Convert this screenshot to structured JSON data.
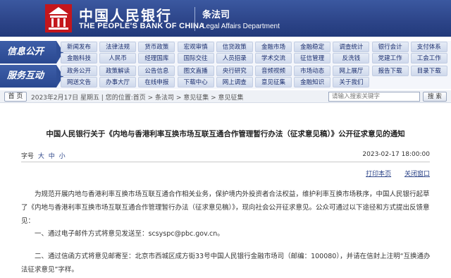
{
  "header": {
    "bank_name_cn": "中国人民银行",
    "bank_name_en": "THE PEOPLE'S BANK OF CHINA",
    "dept_cn": "条法司",
    "dept_en": "Legal Affairs Department"
  },
  "nav": {
    "section1_label": "信息公开",
    "section2_label": "服务互动",
    "row1": [
      "新闻发布",
      "法律法规",
      "货币政策",
      "宏观审慎",
      "信贷政策",
      "金融市场",
      "金融稳定",
      "调查统计",
      "银行会计",
      "支付体系"
    ],
    "row2": [
      "金融科技",
      "人民币",
      "经理国库",
      "国际交往",
      "人员招录",
      "学术交流",
      "征信管理",
      "反洗钱",
      "党建工作",
      "工会工作"
    ],
    "row3": [
      "政务公开",
      "政策解读",
      "公告信息",
      "图文直播",
      "央行研究",
      "音频视频",
      "市场动态",
      "网上展厅",
      "报告下载",
      "目录下载"
    ],
    "row4": [
      "网送文告",
      "办事大厅",
      "在线申报",
      "下载中心",
      "网上调查",
      "意见征集",
      "金融知识",
      "关于我们",
      "",
      ""
    ]
  },
  "breadcrumb": {
    "home_label": "首 页",
    "text": "2023年2月17日 星期五 | 您的位置:首页 > 条法司 > 意见征集 > 意见征集",
    "search_placeholder": "请输入搜索关键字",
    "search_button": "搜 索"
  },
  "article": {
    "title": "中国人民银行关于《内地与香港利率互换市场互联互通合作管理暂行办法（征求意见稿）》公开征求意见的通知",
    "font_size_label": "字号",
    "font_sizes": [
      "大",
      "中",
      "小"
    ],
    "date": "2023-02-17 18:00:00",
    "print_label": "打印本页",
    "close_label": "关闭窗口",
    "paragraphs": [
      "为规范开展内地与香港利率互换市场互联互通合作相关业务，保护境内外投资者合法权益，维护利率互换市场秩序，中国人民银行起草了《内地与香港利率互换市场互联互通合作管理暂行办法（征求意见稿）》，现向社会公开征求意见。公众可通过以下途径和方式提出反馈意见：",
      "一、通过电子邮件方式将意见发送至：scsyspc@pbc.gov.cn。",
      "二、通过信函方式将意见邮寄至：北京市西城区成方街33号中国人民银行金融市场司（邮编：100080），并请在信封上注明“互换通办法征求意见”字样。"
    ]
  },
  "colors": {
    "header_blue": "#2c4488",
    "link_blue": "#2c4488"
  }
}
